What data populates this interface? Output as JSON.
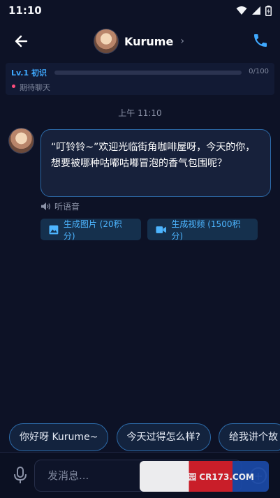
{
  "status_bar": {
    "time": "11:10"
  },
  "header": {
    "name": "Kurume",
    "chevron": "›"
  },
  "level": {
    "label": "Lv.1 初识",
    "progress_text": "0/100",
    "progress_fraction": 0.0,
    "status_text": "期待聊天"
  },
  "chat": {
    "timestamp": "上午 11:10",
    "message": "“叮铃铃~”欢迎光临街角咖啡屋呀，今天的你，想要被哪种咕嘟咕嘟冒泡的香气包围呢？",
    "listen_label": "听语音",
    "gen_image_label": "生成图片 (20积分)",
    "gen_video_label": "生成视频 (1500积分)"
  },
  "suggestions": [
    "你好呀 Kurume~",
    "今天过得怎么样?",
    "给我讲个故"
  ],
  "input": {
    "placeholder": "发消息..."
  },
  "watermark": {
    "text": "西西软件园 CR173.COM"
  },
  "colors": {
    "background": "#0d1226",
    "accent": "#3fa9ff",
    "bubble_border": "#2c6aa8",
    "status_dot": "#ff4d7d"
  }
}
